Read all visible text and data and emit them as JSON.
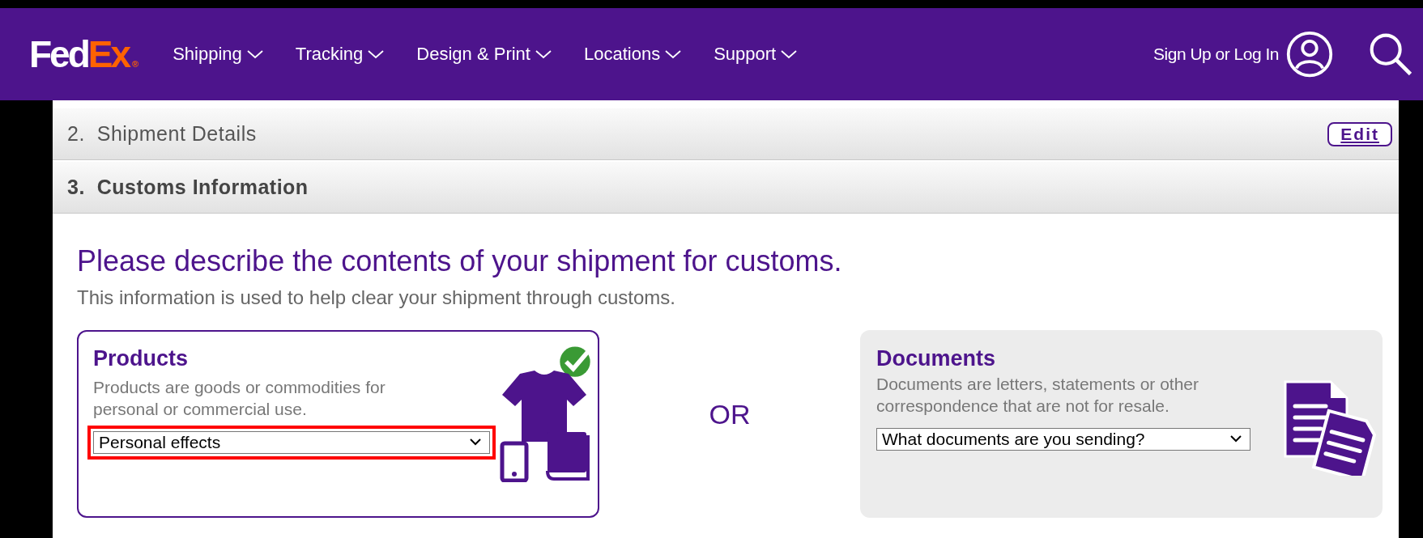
{
  "header": {
    "logo": {
      "part_1": "Fed",
      "part_2": "Ex",
      "mark": "®"
    },
    "nav": [
      {
        "label": "Shipping"
      },
      {
        "label": "Tracking"
      },
      {
        "label": "Design & Print"
      },
      {
        "label": "Locations"
      },
      {
        "label": "Support"
      }
    ],
    "login": "Sign Up or Log In"
  },
  "steps": [
    {
      "number": "2.",
      "title": "Shipment Details",
      "expanded": false,
      "action": "Edit"
    },
    {
      "number": "3.",
      "title": "Customs Information",
      "expanded": true
    }
  ],
  "heading": "Please describe the contents of your shipment for customs.",
  "subtitle": "This information is used to help clear your shipment through customs.",
  "options": [
    {
      "kind": "products",
      "title": "Products",
      "description": "Products are goods or commodities for personal or commercial use.",
      "select": {
        "value": "Personal effects",
        "highlighted": true
      },
      "selected": true
    },
    {
      "kind": "documents",
      "title": "Documents",
      "description": "Documents are letters, statements or other correspondence that are not for resale.",
      "select": {
        "value": "What documents are you sending?",
        "highlighted": false
      },
      "selected": false
    }
  ],
  "separator": "OR"
}
